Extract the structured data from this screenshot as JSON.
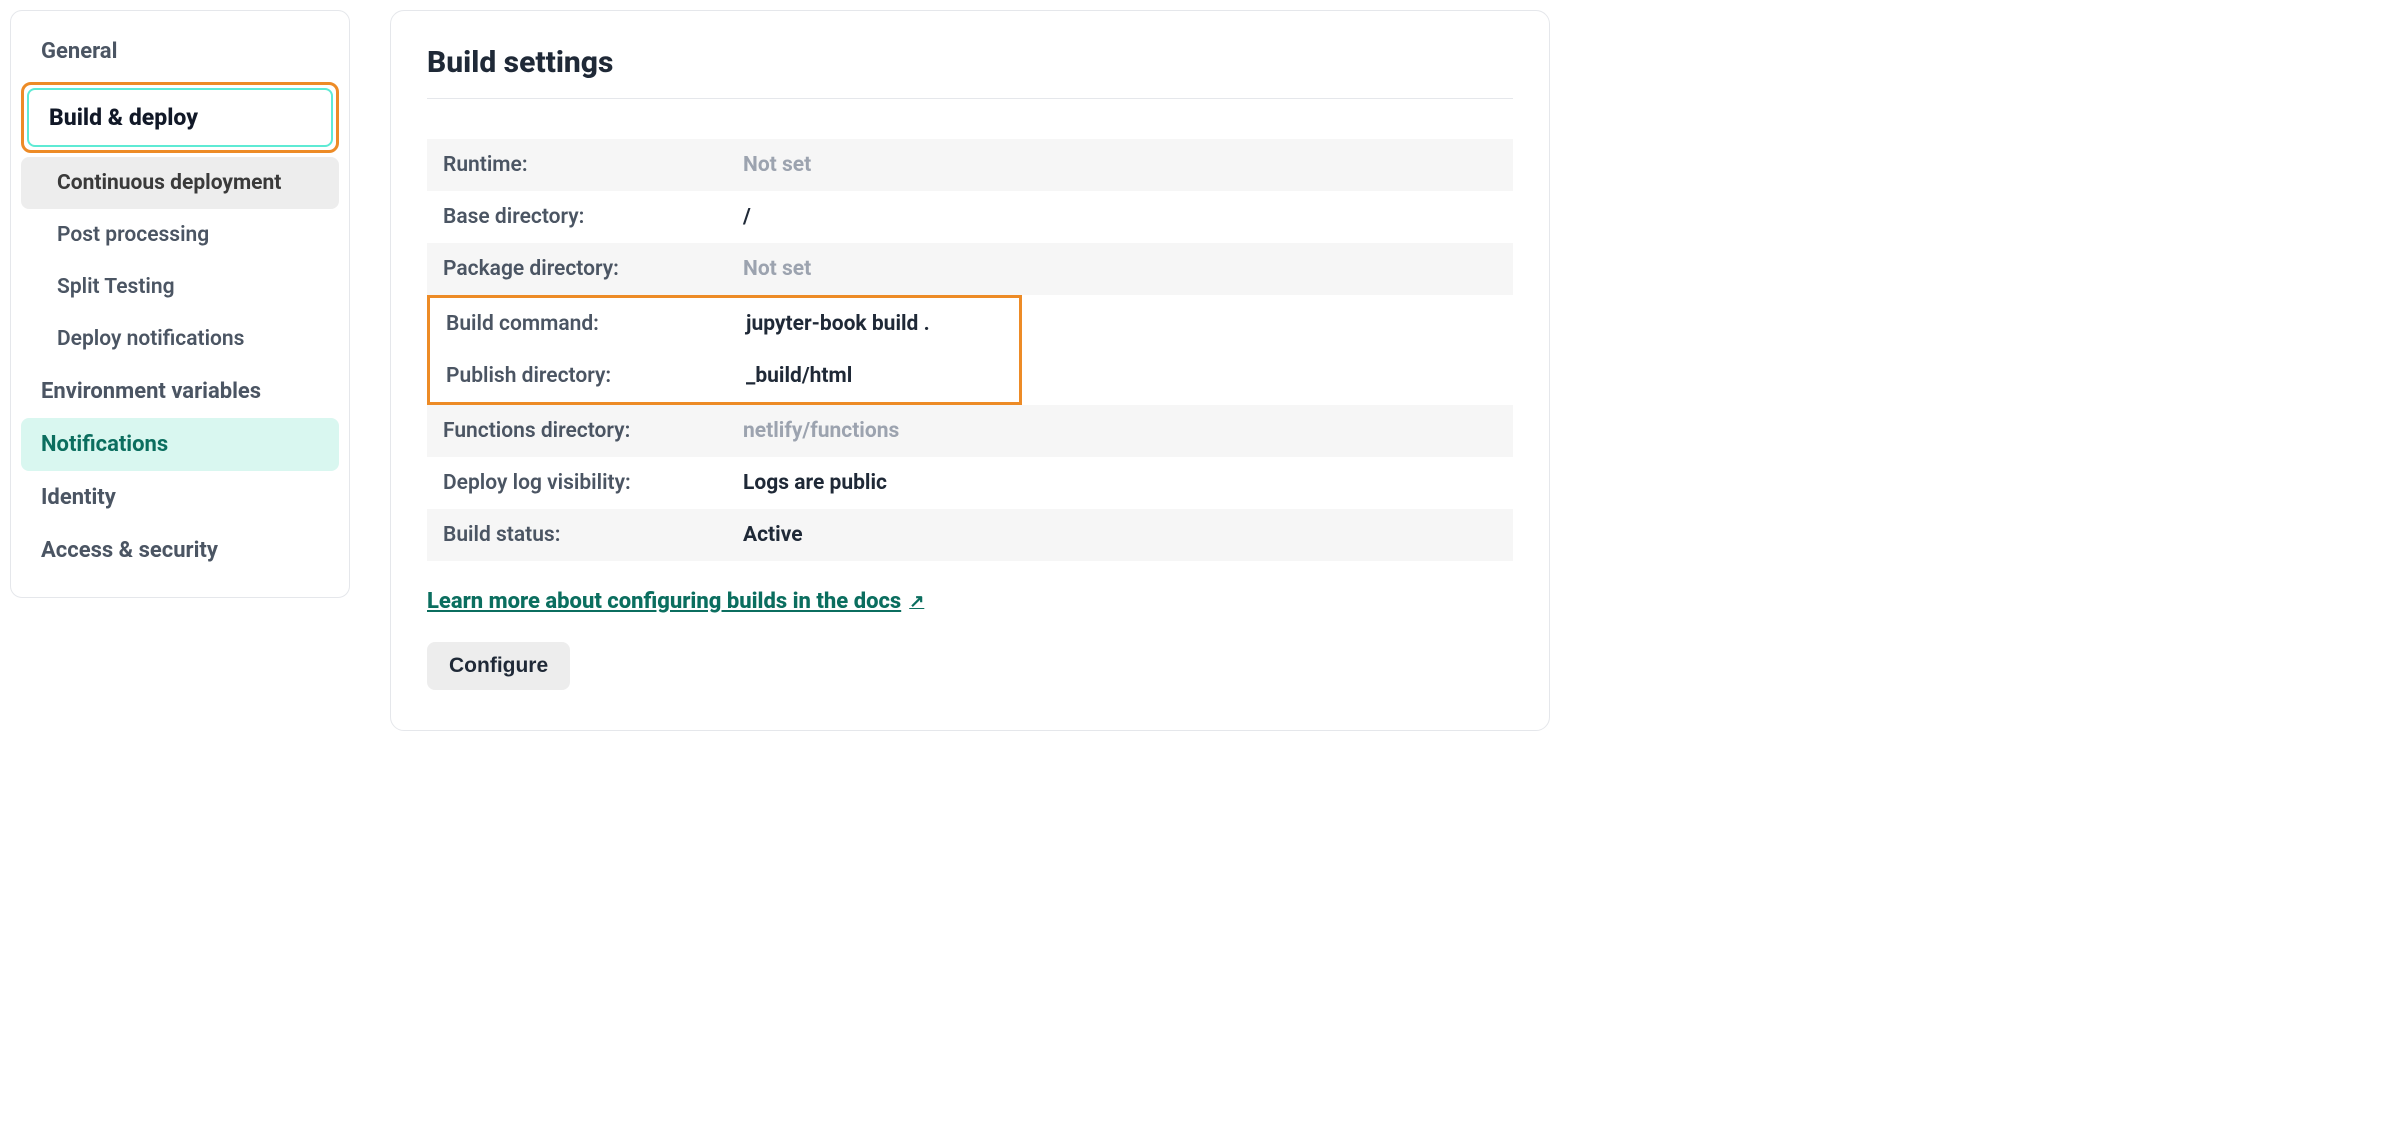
{
  "sidebar": {
    "general": "General",
    "build_deploy": "Build & deploy",
    "sub": {
      "continuous_deployment": "Continuous deployment",
      "post_processing": "Post processing",
      "split_testing": "Split Testing",
      "deploy_notifications": "Deploy notifications"
    },
    "environment_variables": "Environment variables",
    "notifications": "Notifications",
    "identity": "Identity",
    "access_security": "Access & security"
  },
  "main": {
    "title": "Build settings",
    "rows": {
      "runtime_label": "Runtime:",
      "runtime_value": "Not set",
      "base_dir_label": "Base directory:",
      "base_dir_value": "/",
      "package_dir_label": "Package directory:",
      "package_dir_value": "Not set",
      "build_cmd_label": "Build command:",
      "build_cmd_value": "jupyter-book build .",
      "publish_dir_label": "Publish directory:",
      "publish_dir_value": "_build/html",
      "functions_dir_label": "Functions directory:",
      "functions_dir_value": "netlify/functions",
      "deploy_log_label": "Deploy log visibility:",
      "deploy_log_value": "Logs are public",
      "build_status_label": "Build status:",
      "build_status_value": "Active"
    },
    "docs_link": "Learn more about configuring builds in the docs",
    "configure_button": "Configure"
  },
  "highlight": {
    "orange_color": "#ed8b26",
    "teal_color": "#5eead4"
  }
}
